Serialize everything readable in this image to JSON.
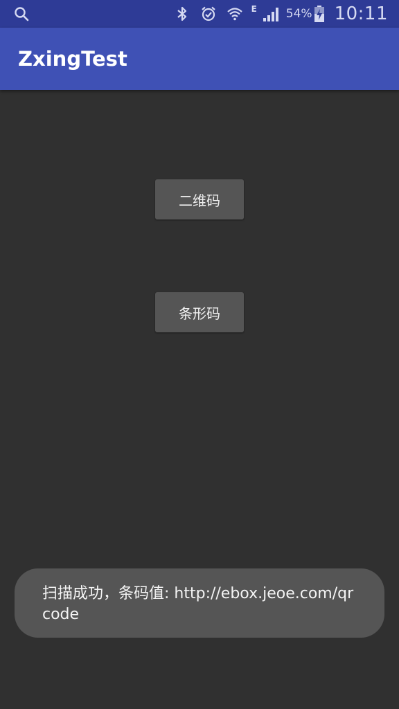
{
  "status_bar": {
    "icons": [
      "search-icon",
      "bluetooth-icon",
      "alarm-icon",
      "wifi-icon",
      "signal-icon",
      "battery-icon"
    ],
    "network_type": "E",
    "battery_percent": "54%",
    "time": "10:11"
  },
  "app_bar": {
    "title": "ZxingTest",
    "color": "#3f51b5"
  },
  "buttons": {
    "qr_label": "二维码",
    "barcode_label": "条形码"
  },
  "toast": {
    "message": "扫描成功，条码值: http://ebox.jeoe.com/qrcode"
  },
  "colors": {
    "status_bar": "#2e3b96",
    "background": "#303030",
    "button": "#555555"
  }
}
